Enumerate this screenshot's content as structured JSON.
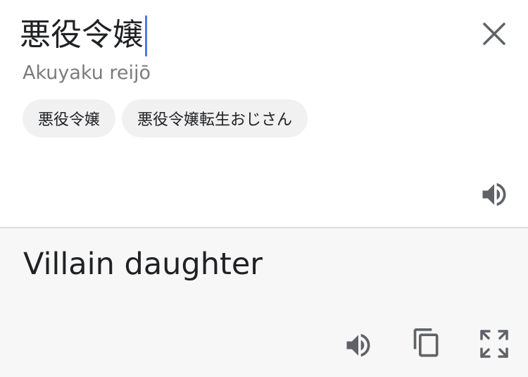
{
  "source": {
    "input_text": "悪役令嬢",
    "romanization": "Akuyaku reijō",
    "suggestions": [
      "悪役令嬢",
      "悪役令嬢転生おじさん"
    ],
    "close_icon": "close-icon",
    "speaker_icon": "speaker-icon"
  },
  "target": {
    "translation": "Villain daughter",
    "icons": [
      "speaker-icon",
      "copy-icon",
      "fullscreen-icon"
    ]
  },
  "colors": {
    "caret": "#4a78e6",
    "target_background": "#f7f7f7",
    "chip_background": "#f1f1f1",
    "icon": "#5f6368"
  }
}
